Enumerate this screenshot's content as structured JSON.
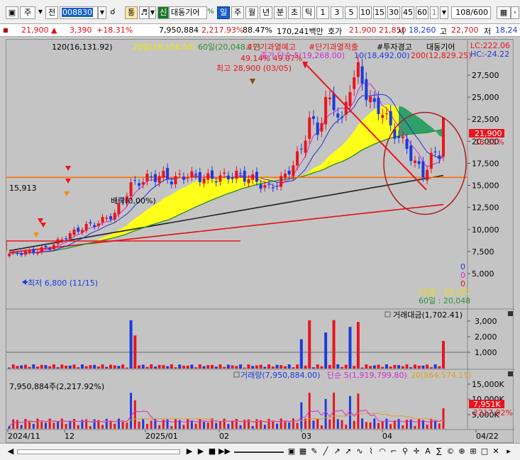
{
  "toolbar": {
    "window_icon": "window-icon",
    "market_select": "주",
    "prev_label": "전",
    "code_value": "008830",
    "lock_label": "통",
    "sound_icon": "speaker-icon",
    "credit_badge": "신",
    "stock_name": "대동기어",
    "periods": [
      "일",
      "주",
      "월",
      "년",
      "분",
      "초",
      "틱"
    ],
    "active_period": "일",
    "minutes": [
      "1",
      "3",
      "5",
      "10",
      "15",
      "30",
      "45",
      "60"
    ],
    "minute_extra": "1",
    "count_display": "108/600"
  },
  "pricebar": {
    "price": "21,900",
    "change_arrow": "▲",
    "change": "3,390",
    "change_pct": "+18.31%",
    "volume": "7,950,884",
    "turnover_pct": "2,217.93%",
    "other_pct": "88.47%",
    "amount": "170,241백만",
    "quote_label": "호가",
    "ask": "21,900",
    "bid": "21,850",
    "open_label": "시",
    "open": "18,260",
    "high_label": "고",
    "high": "22,700",
    "low_label": "저",
    "low": "18,24"
  },
  "main_panel": {
    "ma120_label": "120(16,131.92)",
    "ma20_label": "20일(18,156.50)",
    "ma60_label": "60일(20,048.17)",
    "badge1": "#단기과열예고",
    "badge2": "#단기과열적출",
    "badge3": "#투자경고",
    "stock_label": "대동기어",
    "lc_label": "LC:222.06",
    "hc_label": "HC:-24.22",
    "ma_close_label": "종가 단순 5(19,268.00)",
    "ma10_label": "10(18,492.00)",
    "ma200_label": "200(12,829.25)",
    "high_annot": "최고 28,900 (03/05)",
    "high_pct": "49.14%  49.07%",
    "low_annot": "최저 6,800 (11/15)",
    "level_label": "15,913",
    "bakreak_label": "배락(0,00%)",
    "price_tag": "21,900",
    "price_tag_pct": "18.31%",
    "ma20_bottom": "20일 : 18,157",
    "ma60_bottom": "60일 : 20,048",
    "zero_labels": [
      "0",
      "0",
      "0"
    ],
    "y_ticks": [
      "27,500",
      "25,000",
      "22,500",
      "20,000",
      "17,500",
      "15,000",
      "12,500",
      "10,000",
      "7,500",
      "5,000"
    ]
  },
  "amount_panel": {
    "title": "거래대금(1,702.41)",
    "y_ticks": [
      "3,000",
      "2,000",
      "1,000"
    ]
  },
  "volume_panel": {
    "left_label": "7,950,884주(2,217.92%)",
    "vol_label": "거래량(7,950,884.00)",
    "ma5_label": "단순 5(1,919,799.80)",
    "ma20_label": "20(864,574.15)",
    "y_ticks": [
      "15,000K",
      "10,000K",
      "5,000K"
    ],
    "vol_tag": "7,951K",
    "vol_pct": "2217.92%"
  },
  "x_axis": {
    "labels": [
      "2024/11",
      "12",
      "2025/01",
      "02",
      "03",
      "04",
      "04/22"
    ]
  },
  "colors": {
    "up": "#e8141e",
    "down": "#1a3ae0",
    "ma20_fill": "#ffff1a",
    "ma60": "#2f8f2f",
    "ma120": "#222222",
    "ma200": "#e01010",
    "ma5": "#d22bd2",
    "ma10": "#2030d0",
    "level": "#ff6a00"
  },
  "chart_data": {
    "type": "candlestick",
    "title": "대동기어",
    "x_start": "2024/11",
    "x_end": "04/22",
    "ylim": [
      5000,
      28900
    ],
    "y_ticks": [
      5000,
      7500,
      10000,
      12500,
      15000,
      17500,
      20000,
      22500,
      25000,
      27500
    ],
    "last_close": 21900,
    "period_high": 28900,
    "period_low": 6800,
    "level_line": 15913,
    "moving_averages": {
      "ma5": 19268,
      "ma10": 18492,
      "ma20": 18156.5,
      "ma60": 20048.17,
      "ma120": 16131.92,
      "ma200": 12829.25
    },
    "amount_ylim": [
      0,
      3500
    ],
    "volume_last": 7950884,
    "volume_ylim": [
      0,
      17000000
    ]
  }
}
